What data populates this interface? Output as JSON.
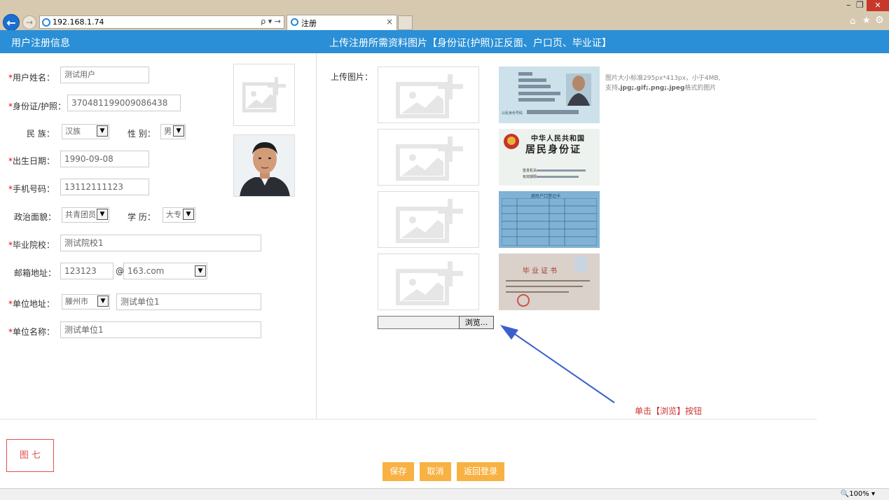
{
  "browser": {
    "address": "192.168.1.74",
    "address_tools": "ρ ▾ →",
    "tab_title": "注册",
    "tab_close": "×",
    "back_glyph": "←",
    "forward_glyph": "→",
    "minimize": "–",
    "maximize": "❐",
    "close": "✕",
    "home_glyph": "⌂",
    "star_glyph": "★",
    "gear_glyph": "⚙"
  },
  "header": {
    "left_title": "用户注册信息",
    "right_title": "上传注册所需资料图片【身份证(护照)正反面、户口页、毕业证】"
  },
  "form": {
    "required_mark": "*",
    "name_label": "用户姓名：",
    "name_value": "测试用户",
    "id_label": "身份证/护照：",
    "id_value": "370481199009086438",
    "ethnicity_label": "民 族：",
    "ethnicity_value": "汉族",
    "gender_label": "性 别：",
    "gender_value": "男",
    "birth_label": "出生日期：",
    "birth_value": "1990-09-08",
    "phone_label": "手机号码：",
    "phone_value": "13112111123",
    "political_label": "政治面貌：",
    "political_value": "共青团员",
    "education_label": "学 历：",
    "education_value": "大专",
    "school_label": "毕业院校：",
    "school_value": "测试院校1",
    "email_label": "邮箱地址：",
    "email_user": "123123",
    "email_at": "@",
    "email_domain": "163.com",
    "unit_addr_label": "单位地址：",
    "unit_city": "滕州市",
    "unit_addr_value": "测试单位1",
    "unit_name_label": "单位名称：",
    "unit_name_value": "测试单位1",
    "select_arrow": "▼"
  },
  "upload": {
    "label": "上传图片：",
    "hint_line1": "图片大小标准295px*413px，小于4MB,",
    "hint_line2_prefix": "支持",
    "hint_line2_formats": ".jpg;.gif;.png;.jpeg",
    "hint_line2_suffix": "格式的图片",
    "browse_label": "浏览...",
    "thumb1_card_text": "公民身份号码",
    "thumb2_title1": "中华人民共和国",
    "thumb2_title2": "居民身份证",
    "thumb2_label1": "签发机关",
    "thumb2_label2": "有效期限",
    "thumb3_title": "居民户口登记卡",
    "thumb4_title": "毕业证书",
    "annotation": "单击【浏览】按钮"
  },
  "figure_label": "图 七",
  "buttons": {
    "save": "保存",
    "cancel": "取消",
    "back_login": "返回登录"
  },
  "status": {
    "zoom": "🔍100%  ▾"
  },
  "colors": {
    "header_bg": "#2a8fd6",
    "button_bg": "#f8b243",
    "required": "#ee0000",
    "annotation": "#d03030",
    "arrow": "#3a5fcd"
  }
}
